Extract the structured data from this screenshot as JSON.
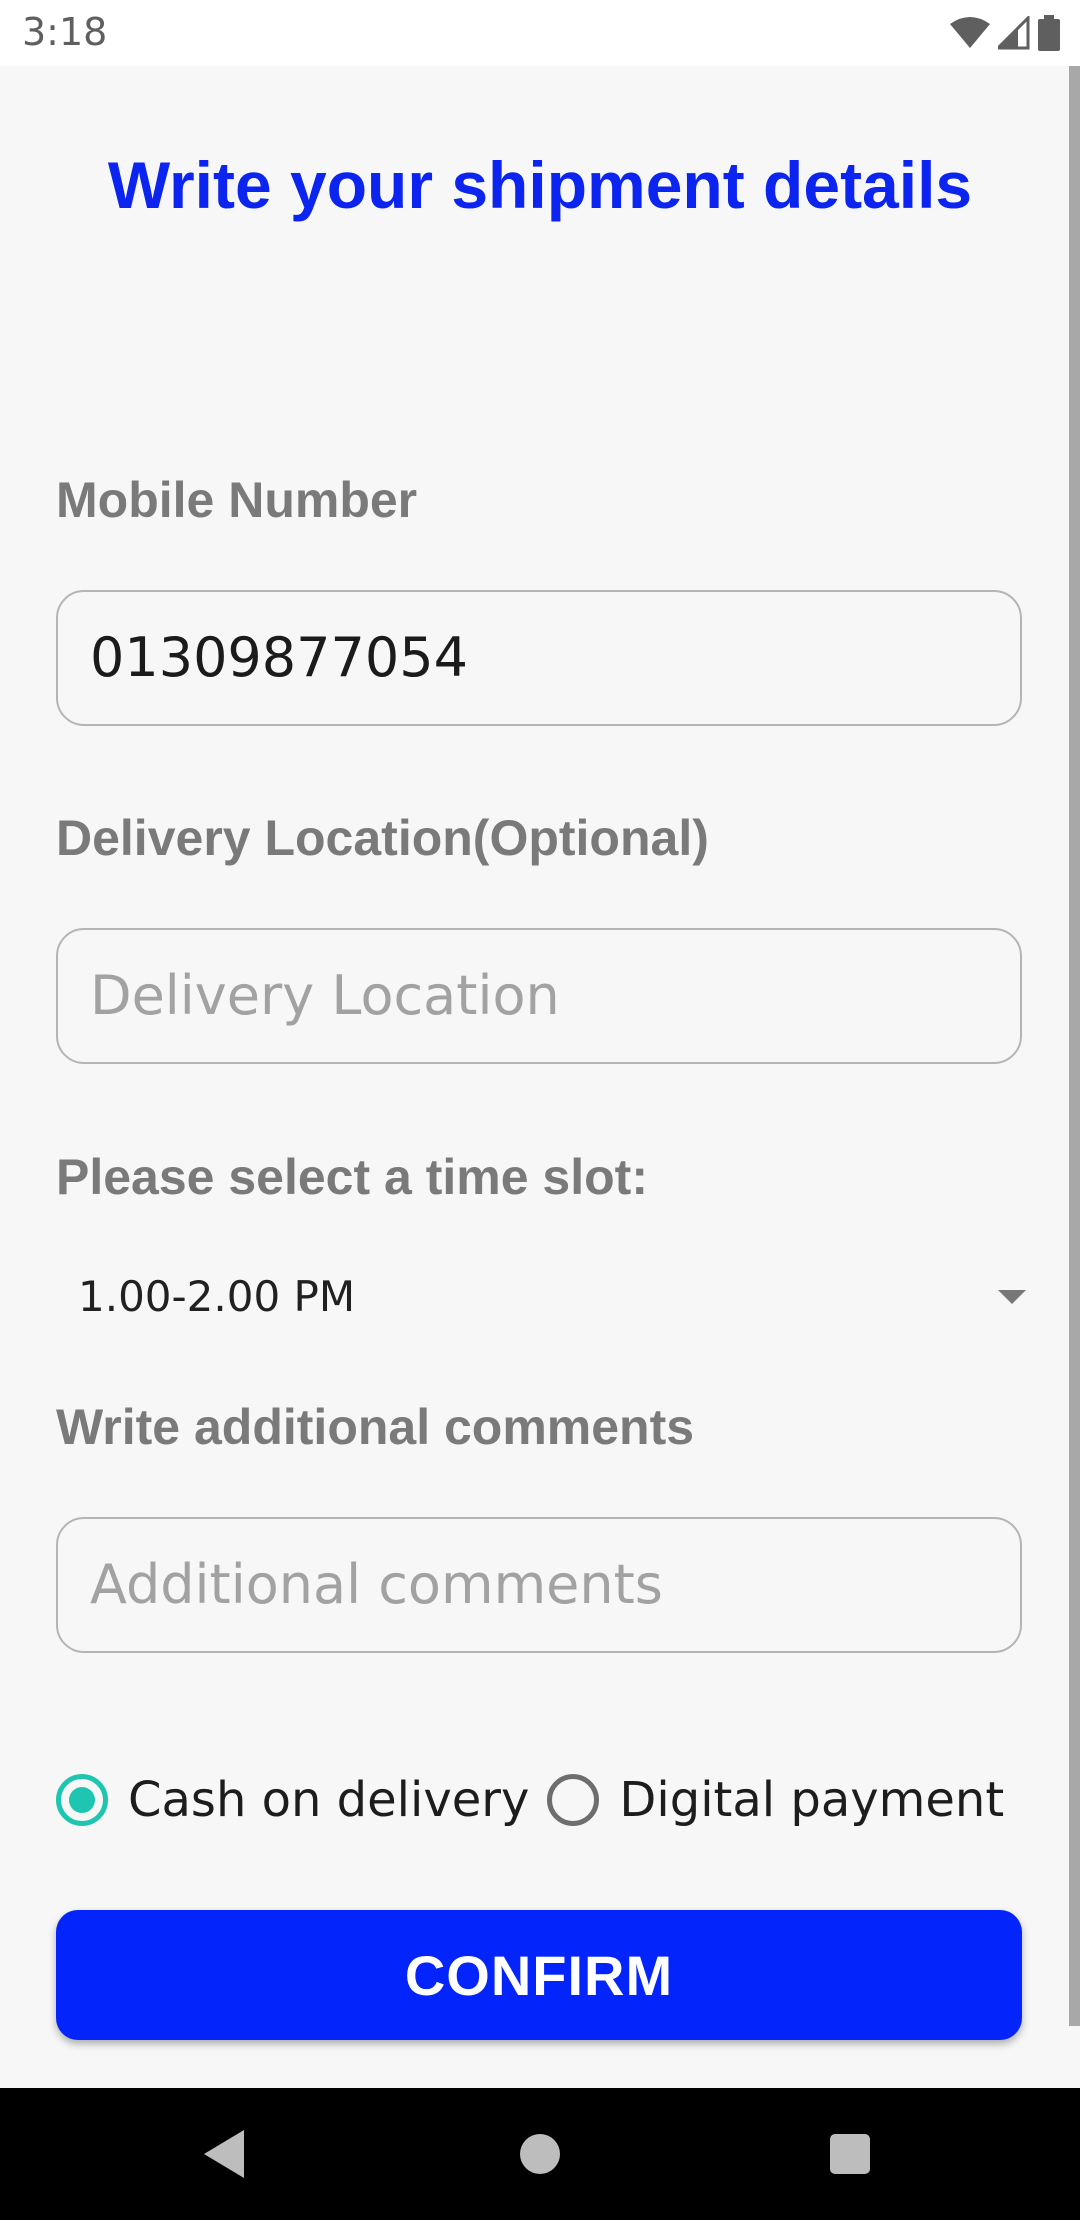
{
  "status_bar": {
    "time": "3:18",
    "icons": [
      "wifi-icon",
      "signal-icon",
      "battery-icon"
    ]
  },
  "page": {
    "title": "Write your shipment details"
  },
  "mobile": {
    "label": "Mobile Number",
    "value": "01309877054"
  },
  "delivery": {
    "label": "Delivery Location(Optional)",
    "placeholder": "Delivery Location",
    "value": ""
  },
  "time_slot": {
    "label": "Please select a time slot:",
    "selected": "1.00-2.00 PM"
  },
  "comments": {
    "label": "Write additional comments",
    "placeholder": "Additional comments",
    "value": ""
  },
  "payment": {
    "options": [
      {
        "label": "Cash on delivery",
        "checked": true
      },
      {
        "label": "Digital payment",
        "checked": false
      }
    ]
  },
  "confirm": {
    "label": "CONFIRM"
  },
  "colors": {
    "title": "#0b24f0",
    "button": "#0324fb",
    "radio_checked": "#1ec6b1",
    "label": "#7a7a7a"
  },
  "nav": {
    "icons": [
      "back-icon",
      "home-icon",
      "recents-icon"
    ]
  }
}
